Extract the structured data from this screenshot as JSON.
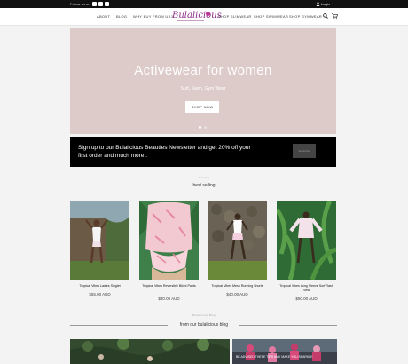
{
  "topbar": {
    "follow": "Follow us on",
    "login": "Login"
  },
  "nav": {
    "left": [
      "ABOUT",
      "BLOG",
      "WHY BUY FROM US?"
    ],
    "right": [
      "SHOP SLIMWEAR",
      "SHOP SWIMWEAR",
      "SHOP GYMWEAR"
    ],
    "logo": "Bulalicious",
    "brand_color": "#8e2f8a"
  },
  "hero": {
    "title": "Activewear for women",
    "subtitle": "Surf, Swim, Gym Wear",
    "button": "SHOP NOW",
    "bg_color": "#dccbc8"
  },
  "newsletter": {
    "text": "Sign up to our Bulalicious Beauties Newsletter and get 20% off your first order and much more..",
    "button": "Subscribe"
  },
  "bestselling": {
    "kicker": "Catalog",
    "title": "best selling"
  },
  "products": [
    {
      "name": "Tropical Vibes Ladies Singlet",
      "price": "$55.00 AUD"
    },
    {
      "name": "Tropical Vibes Reversible Bikini Pants",
      "price": "$30.00 AUD"
    },
    {
      "name": "Tropical Vibes Mesh Running Shorts",
      "price": "$40.00 AUD"
    },
    {
      "name": "Tropical Vibes Long Sleeve Surf Rash Vest",
      "price": "$50.00 AUD"
    }
  ],
  "blog": {
    "kicker": "Bulalicious Blog",
    "title": "from our bulalicious blog",
    "caption": "BE ADVISED THESE TIPS MAY MAKE YOU SPARKLE"
  }
}
